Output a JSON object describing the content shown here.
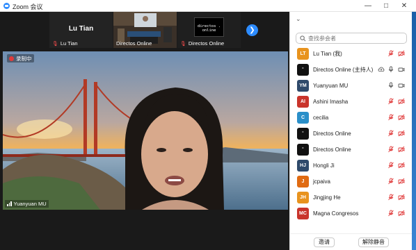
{
  "window": {
    "title": "Zoom 会议"
  },
  "thumbnails": [
    {
      "name": "Lu Tian",
      "display": "Lu Tian"
    },
    {
      "name": "Directos Online"
    },
    {
      "name": "Directos Online",
      "logo_text": "directos . online"
    }
  ],
  "recording": {
    "label": "录制中"
  },
  "speaker": {
    "name": "Yuanyuan MU"
  },
  "panel": {
    "search_placeholder": "查找参会者",
    "invite_label": "邀请",
    "unmute_all_label": "解除静音"
  },
  "participants": [
    {
      "initials": "LT",
      "name": "Lu Tian (我)",
      "color": "#e8931e",
      "mic": "muted",
      "video": "off"
    },
    {
      "initials": "",
      "name": "Directos Online (主持人)",
      "color": "#111111",
      "mic": "on",
      "video": "on",
      "extra": "share"
    },
    {
      "initials": "YM",
      "name": "Yuanyuan MU",
      "color": "#2f4a6b",
      "mic": "on",
      "video": "on"
    },
    {
      "initials": "AI",
      "name": "Ashini Imasha",
      "color": "#c9342b",
      "mic": "muted",
      "video": "off"
    },
    {
      "initials": "C",
      "name": "cecilia",
      "color": "#2a8fc9",
      "mic": "muted",
      "video": "off"
    },
    {
      "initials": "",
      "name": "Directos Online",
      "color": "#111111",
      "mic": "muted",
      "video": "off"
    },
    {
      "initials": "",
      "name": "Directos Online",
      "color": "#111111",
      "mic": "muted",
      "video": "off"
    },
    {
      "initials": "HJ",
      "name": "Hongli Ji",
      "color": "#2f4a6b",
      "mic": "muted",
      "video": "off"
    },
    {
      "initials": "J",
      "name": "jcpaiva",
      "color": "#e06b12",
      "mic": "muted",
      "video": "off"
    },
    {
      "initials": "JH",
      "name": "Jingjing He",
      "color": "#e8931e",
      "mic": "muted",
      "video": "off"
    },
    {
      "initials": "MC",
      "name": "Magna Congresos",
      "color": "#c9342b",
      "mic": "muted",
      "video": "off"
    }
  ]
}
